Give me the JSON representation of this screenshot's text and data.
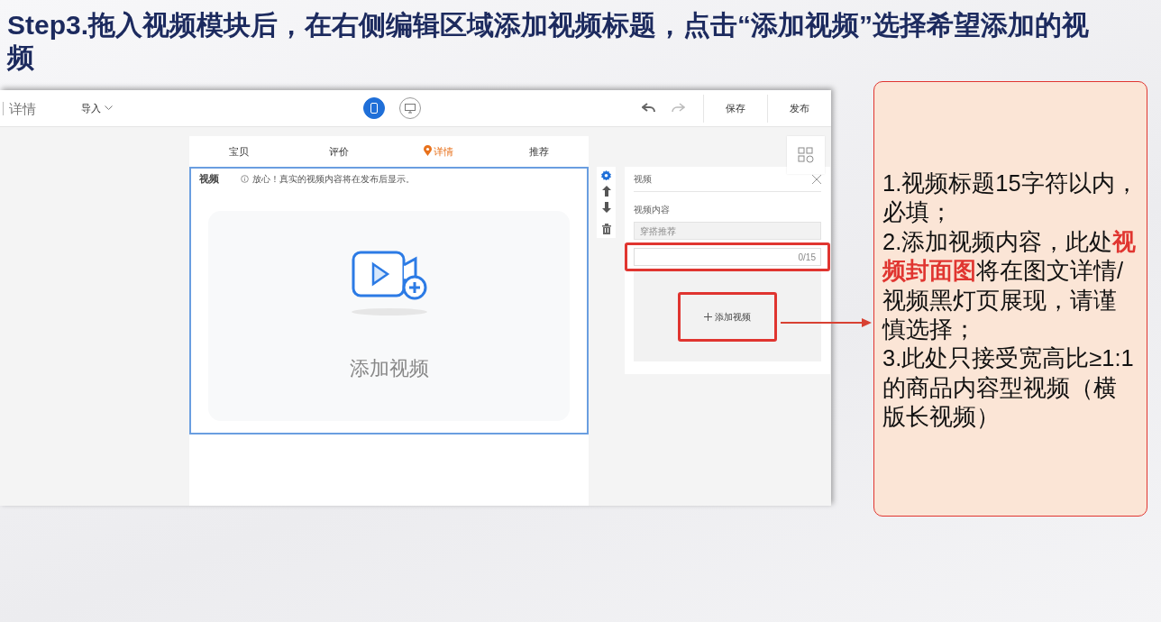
{
  "title": "Step3.拖入视频模块后，在右侧编辑区域添加视频标题，点击“添加视频”选择希望添加的视频",
  "app": {
    "toolbar": {
      "page_title": "详情",
      "import_menu": "导入",
      "view_toggles": [
        {
          "kind": "mobile",
          "selected": true
        },
        {
          "kind": "desktop",
          "selected": false
        }
      ],
      "buttons": [
        "保存",
        "发布"
      ]
    },
    "tabs": [
      {
        "label": "宝贝",
        "selected": false
      },
      {
        "label": "评价",
        "selected": false
      },
      {
        "label": "详情",
        "selected": true
      },
      {
        "label": "推荐",
        "selected": false
      }
    ],
    "module": {
      "title": "视频",
      "notice": "放心！真实的视频内容将在发布后显示。",
      "upload_label": "添加视频"
    },
    "panel": {
      "title": "视频",
      "field_label": "视频内容",
      "preset_value": "穿搭推荐",
      "counter": "0/15",
      "add_button": "添加视频"
    }
  },
  "callout": {
    "items": [
      "1.视频标题15字符以内，必填；",
      "2.添加视频内容，此处**视频封面图**将在图文详情/视频黑灯页展现，请谨慎选择；",
      "3.此处只接受宽高比≥1:1的商品内容型视频（横版长视频）"
    ]
  }
}
